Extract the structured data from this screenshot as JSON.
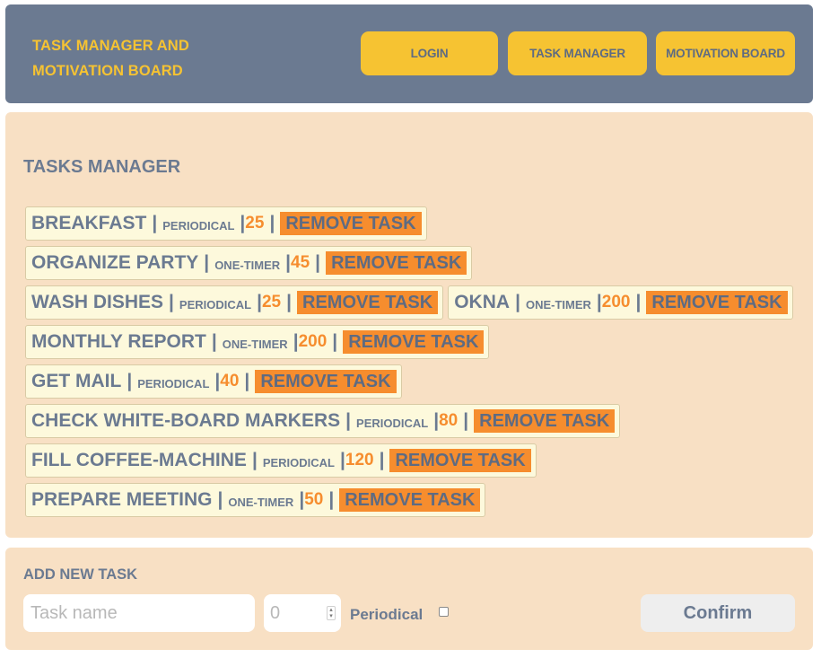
{
  "header": {
    "brand_line1": "TASK MANAGER AND",
    "brand_line2": "MOTIVATION BOARD",
    "nav": [
      {
        "label": "LOGIN"
      },
      {
        "label": "TASK MANAGER"
      },
      {
        "label": "MOTIVATION BOARD"
      }
    ]
  },
  "tasks_section": {
    "title": "TASKS MANAGER",
    "separator": "|",
    "remove_label": "REMOVE TASK",
    "tasks": [
      {
        "name": "BREAKFAST",
        "type": "PERIODICAL",
        "points": "25"
      },
      {
        "name": "ORGANIZE PARTY",
        "type": "ONE-TIMER",
        "points": "45"
      },
      {
        "name": "WASH DISHES",
        "type": "PERIODICAL",
        "points": "25"
      },
      {
        "name": "OKNA",
        "type": "ONE-TIMER",
        "points": "200"
      },
      {
        "name": "MONTHLY REPORT",
        "type": "ONE-TIMER",
        "points": "200"
      },
      {
        "name": "GET MAIL",
        "type": "PERIODICAL",
        "points": "40"
      },
      {
        "name": "CHECK WHITE-BOARD MARKERS",
        "type": "PERIODICAL",
        "points": "80"
      },
      {
        "name": "FILL COFFEE-MACHINE",
        "type": "PERIODICAL",
        "points": "120"
      },
      {
        "name": "PREPARE MEETING",
        "type": "ONE-TIMER",
        "points": "50"
      }
    ]
  },
  "add_section": {
    "title": "ADD NEW TASK",
    "task_name_placeholder": "Task name",
    "points_value": "0",
    "periodical_label": "Periodical",
    "periodical_checked": false,
    "confirm_label": "Confirm"
  },
  "colors": {
    "header_bg": "#6b7a91",
    "accent_yellow": "#f6c332",
    "panel_bg": "#f8e0c4",
    "task_bg": "#fdf9dc",
    "accent_orange": "#f68d2e",
    "text_slate": "#6b7a91"
  }
}
